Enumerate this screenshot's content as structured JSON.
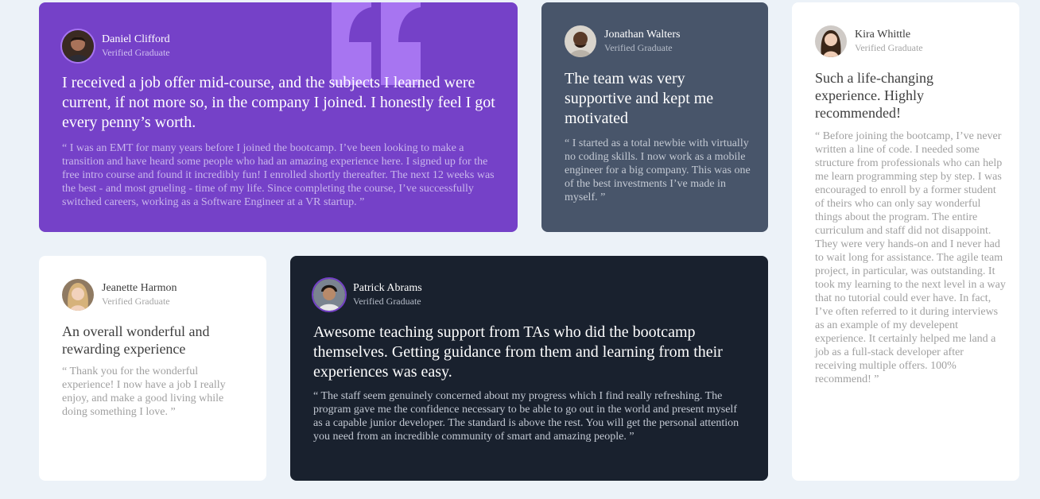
{
  "testimonials": [
    {
      "name": "Daniel Clifford",
      "status": "Verified Graduate",
      "headline": "I received a job offer mid-course, and the subjects I learned were current, if not more so, in the company I joined. I honestly feel I got every penny’s worth.",
      "body": "“ I was an EMT for many years before I joined the bootcamp. I’ve been looking to make a transition and have heard some people who had an amazing experience here. I signed up for the free intro course and found it incredibly fun! I enrolled shortly thereafter. The next 12 weeks was the best - and most grueling - time of my life. Since completing the course, I’ve successfully switched careers, working as a Software Engineer at a VR startup. ”",
      "background": "#7541c8"
    },
    {
      "name": "Jonathan Walters",
      "status": "Verified Graduate",
      "headline": "The team was very supportive and kept me motivated",
      "body": "“ I started as a total newbie with virtually no coding skills. I now work as a mobile engineer for a big company. This was one of the best investments I’ve made in myself. ”",
      "background": "#48556a"
    },
    {
      "name": "Kira Whittle",
      "status": "Verified Graduate",
      "headline": "Such a life-changing experience. Highly recommended!",
      "body": "“ Before joining the bootcamp, I’ve never written a line of code. I needed some structure from professionals who can help me learn programming step by step. I was encouraged to enroll by a former student of theirs who can only say wonderful things about the program. The entire curriculum and staff did not disappoint. They were very hands-on and I never had to wait long for assistance. The agile team project, in particular, was outstanding. It took my learning to the next level in a way that no tutorial could ever have. In fact, I’ve often referred to it during interviews as an example of my develepent experience. It certainly helped me land a job as a full-stack developer after receiving multiple offers. 100% recommend! ”",
      "background": "#ffffff"
    },
    {
      "name": "Jeanette Harmon",
      "status": "Verified Graduate",
      "headline": "An overall wonderful and rewarding experience",
      "body": "“ Thank you for the wonderful experience! I now have a job I really enjoy, and make a good living while doing something I love. ”",
      "background": "#ffffff"
    },
    {
      "name": "Patrick Abrams",
      "status": "Verified Graduate",
      "headline": "Awesome teaching support from TAs who did the bootcamp themselves. Getting guidance from them and learning from their experiences was easy.",
      "body": "“ The staff seem genuinely concerned about my progress which I find really refreshing. The program gave me the confidence necessary to be able to go out in the world and present myself as a capable junior developer. The standard is above the rest. You will get the personal attention you need from an incredible community of smart and amazing people. ”",
      "background": "#19212e"
    }
  ],
  "decor": {
    "quote_icon": "quotation-mark-icon",
    "quote_color": "#a775f1",
    "page_background": "#ecf2f8"
  }
}
